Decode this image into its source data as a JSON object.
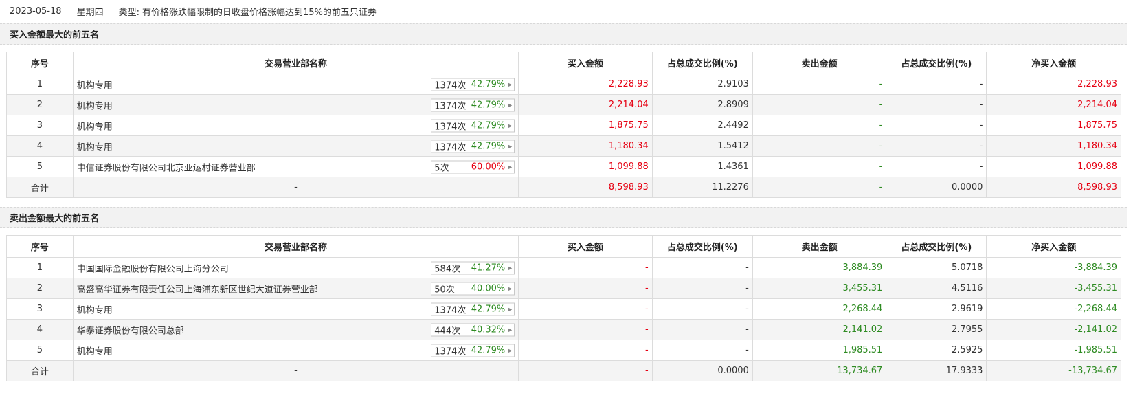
{
  "header": {
    "date": "2023-05-18",
    "weekday": "星期四",
    "type_label": "类型:",
    "type_value": "有价格涨跌幅限制的日收盘价格涨幅达到15%的前五只证券"
  },
  "columns": [
    "序号",
    "交易营业部名称",
    "买入金额",
    "占总成交比例(%)",
    "卖出金额",
    "占总成交比例(%)",
    "净买入金额"
  ],
  "buy_section": {
    "title": "买入金额最大的前五名",
    "rows": [
      {
        "rank": "1",
        "name": "机构专用",
        "count": "1374次",
        "rate": "42.79%",
        "buy": "2,228.93",
        "buy_pct": "2.9103",
        "sell": "-",
        "sell_pct": "-",
        "net": "2,228.93"
      },
      {
        "rank": "2",
        "name": "机构专用",
        "count": "1374次",
        "rate": "42.79%",
        "buy": "2,214.04",
        "buy_pct": "2.8909",
        "sell": "-",
        "sell_pct": "-",
        "net": "2,214.04"
      },
      {
        "rank": "3",
        "name": "机构专用",
        "count": "1374次",
        "rate": "42.79%",
        "buy": "1,875.75",
        "buy_pct": "2.4492",
        "sell": "-",
        "sell_pct": "-",
        "net": "1,875.75"
      },
      {
        "rank": "4",
        "name": "机构专用",
        "count": "1374次",
        "rate": "42.79%",
        "buy": "1,180.34",
        "buy_pct": "1.5412",
        "sell": "-",
        "sell_pct": "-",
        "net": "1,180.34"
      },
      {
        "rank": "5",
        "name": "中信证券股份有限公司北京亚运村证券营业部",
        "count": "5次",
        "rate": "60.00%",
        "buy": "1,099.88",
        "buy_pct": "1.4361",
        "sell": "-",
        "sell_pct": "-",
        "net": "1,099.88"
      }
    ],
    "total": {
      "label": "合计",
      "name": "-",
      "buy": "8,598.93",
      "buy_pct": "11.2276",
      "sell": "-",
      "sell_pct": "0.0000",
      "net": "8,598.93"
    }
  },
  "sell_section": {
    "title": "卖出金额最大的前五名",
    "rows": [
      {
        "rank": "1",
        "name": "中国国际金融股份有限公司上海分公司",
        "count": "584次",
        "rate": "41.27%",
        "buy": "-",
        "buy_pct": "-",
        "sell": "3,884.39",
        "sell_pct": "5.0718",
        "net": "-3,884.39"
      },
      {
        "rank": "2",
        "name": "高盛高华证券有限责任公司上海浦东新区世纪大道证券营业部",
        "count": "50次",
        "rate": "40.00%",
        "buy": "-",
        "buy_pct": "-",
        "sell": "3,455.31",
        "sell_pct": "4.5116",
        "net": "-3,455.31"
      },
      {
        "rank": "3",
        "name": "机构专用",
        "count": "1374次",
        "rate": "42.79%",
        "buy": "-",
        "buy_pct": "-",
        "sell": "2,268.44",
        "sell_pct": "2.9619",
        "net": "-2,268.44"
      },
      {
        "rank": "4",
        "name": "华泰证券股份有限公司总部",
        "count": "444次",
        "rate": "40.32%",
        "buy": "-",
        "buy_pct": "-",
        "sell": "2,141.02",
        "sell_pct": "2.7955",
        "net": "-2,141.02"
      },
      {
        "rank": "5",
        "name": "机构专用",
        "count": "1374次",
        "rate": "42.79%",
        "buy": "-",
        "buy_pct": "-",
        "sell": "1,985.51",
        "sell_pct": "2.5925",
        "net": "-1,985.51"
      }
    ],
    "total": {
      "label": "合计",
      "name": "-",
      "buy": "-",
      "buy_pct": "0.0000",
      "sell": "13,734.67",
      "sell_pct": "17.9333",
      "net": "-13,734.67"
    }
  },
  "colors": {
    "buy_red": "#e60012",
    "sell_green": "#2e8b22",
    "rate_green": "#2e8b22",
    "rate_red": "#e60012"
  },
  "icons": {
    "pill_arrow": "caret-right-icon"
  }
}
